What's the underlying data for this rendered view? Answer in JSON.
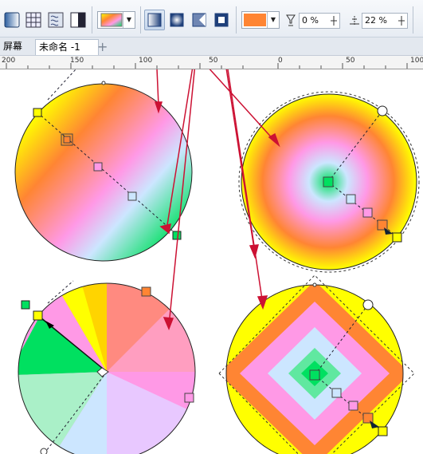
{
  "toolbar": {
    "buttons": [
      {
        "name": "linear-fill-icon",
        "pressed": false
      },
      {
        "name": "grid-fill-icon",
        "pressed": false
      },
      {
        "name": "pattern-fill-icon",
        "pressed": false
      },
      {
        "name": "transparency-fill-icon",
        "pressed": false
      },
      {
        "name": "gradient-preset-icon",
        "pressed": false
      },
      {
        "name": "linear-gradient-icon",
        "pressed": true
      },
      {
        "name": "elliptical-gradient-icon",
        "pressed": false
      },
      {
        "name": "conical-gradient-icon",
        "pressed": false
      },
      {
        "name": "rectangular-gradient-icon",
        "pressed": false
      }
    ],
    "color_swatch": "#ff8533",
    "transparency_value": "0 %",
    "angle_value": "22 %"
  },
  "tabs": {
    "left_label": "屏幕",
    "document_label": "未命名 -1",
    "add_label": "+"
  },
  "ruler": {
    "labels": [
      "200",
      "150",
      "100",
      "50",
      "0",
      "50",
      "100"
    ]
  },
  "colors": {
    "yellow": "#ffff00",
    "orange": "#ff8533",
    "pink": "#ff99e6",
    "light_blue": "#cce6ff",
    "green": "#00e060",
    "arrow_red": "#cc1133"
  }
}
